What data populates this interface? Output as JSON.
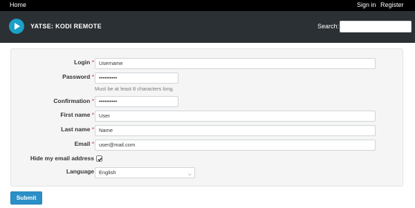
{
  "topbar": {
    "home": "Home",
    "sign_in": "Sign in",
    "register": "Register"
  },
  "header": {
    "brand": "YATSE: KODI REMOTE",
    "search_label": "Search:",
    "search_value": ""
  },
  "form": {
    "login": {
      "label": "Login",
      "required": "*",
      "value": "Username"
    },
    "password": {
      "label": "Password",
      "required": "*",
      "value": "••••••••••",
      "help": "Must be at least 8 characters long."
    },
    "confirmation": {
      "label": "Confirmation",
      "required": "*",
      "value": "••••••••••"
    },
    "first_name": {
      "label": "First name",
      "required": "*",
      "value": "User"
    },
    "last_name": {
      "label": "Last name",
      "required": "*",
      "value": "Name"
    },
    "email": {
      "label": "Email",
      "required": "*",
      "value": "user@mail.com"
    },
    "hide_email": {
      "label": "Hide my email address",
      "checked": true
    },
    "language": {
      "label": "Language",
      "value": "English"
    }
  },
  "submit_label": "Submit",
  "colors": {
    "topbar": "#000000",
    "header": "#2b3034",
    "logo": "#1ba0c8",
    "required": "#c9302c",
    "button": "#2b8fc8"
  },
  "icons": {
    "logo": "play-arrow-icon",
    "checkbox": "check-icon",
    "select": "chevron-down-icon"
  }
}
